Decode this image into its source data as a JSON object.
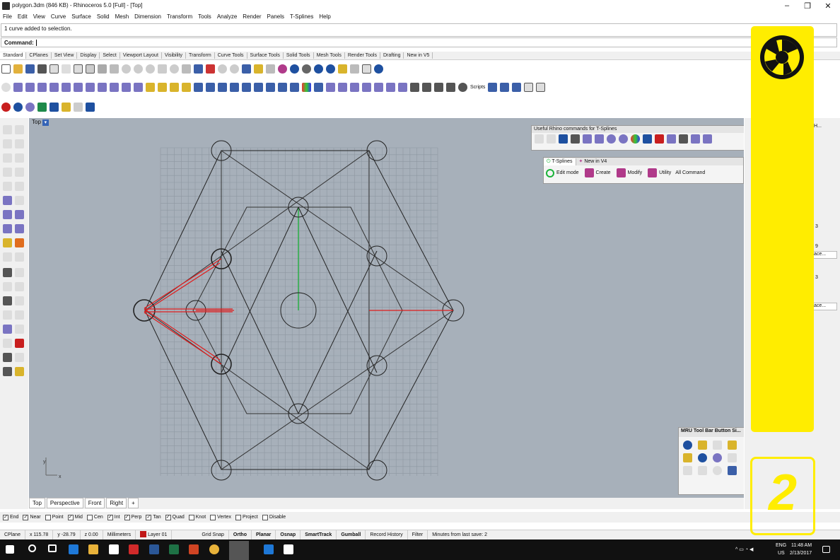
{
  "window": {
    "title": "polygon.3dm (846 KB) - Rhinoceros 5.0 [Full] - [Top]",
    "minimize_glyph": "–",
    "maximize_glyph": "❐",
    "close_glyph": "✕"
  },
  "menu": [
    "File",
    "Edit",
    "View",
    "Curve",
    "Surface",
    "Solid",
    "Mesh",
    "Dimension",
    "Transform",
    "Tools",
    "Analyze",
    "Render",
    "Panels",
    "T-Splines",
    "Help"
  ],
  "command": {
    "history": "1 curve added to selection.",
    "prompt": "Command:"
  },
  "toolbar_tabs": [
    "Standard",
    "CPlanes",
    "Set View",
    "Display",
    "Select",
    "Viewport Layout",
    "Visibility",
    "Transform",
    "Curve Tools",
    "Surface Tools",
    "Solid Tools",
    "Mesh Tools",
    "Render Tools",
    "Drafting",
    "New in V5"
  ],
  "toolbar_row3": {
    "scripts_label": "Scripts"
  },
  "viewport": {
    "name": "Top",
    "dropdown_glyph": "▾",
    "axis_y": "y",
    "axis_x": "x"
  },
  "useful_panel": {
    "title": "Useful Rhino commands for T-Splines"
  },
  "tsplines_panel": {
    "tabs": [
      "T-Splines",
      "New in V4"
    ],
    "buttons": [
      "Edit mode",
      "Create",
      "Modify",
      "Utility",
      "All Command"
    ]
  },
  "mru_panel": {
    "title": "MRU Tool Bar Button Si..."
  },
  "view_tabs": [
    "Top",
    "Perspective",
    "Front",
    "Right"
  ],
  "view_tab_add": "+",
  "osnaps": [
    {
      "label": "End",
      "checked": true
    },
    {
      "label": "Near",
      "checked": true
    },
    {
      "label": "Point",
      "checked": false
    },
    {
      "label": "Mid",
      "checked": true
    },
    {
      "label": "Cen",
      "checked": false
    },
    {
      "label": "Int",
      "checked": true
    },
    {
      "label": "Perp",
      "checked": true
    },
    {
      "label": "Tan",
      "checked": true
    },
    {
      "label": "Quad",
      "checked": true
    },
    {
      "label": "Knot",
      "checked": false
    },
    {
      "label": "Vertex",
      "checked": false
    },
    {
      "label": "Project",
      "checked": false
    },
    {
      "label": "Disable",
      "checked": false
    }
  ],
  "status": {
    "cplane": "CPlane",
    "x": "x 115.78",
    "y": "y -28.79",
    "z": "z 0.00",
    "units": "Millimeters",
    "layer": "Layer 01",
    "toggles": [
      "Grid Snap",
      "Ortho",
      "Planar",
      "Osnap",
      "SmartTrack",
      "Gumball",
      "Record History",
      "Filter"
    ],
    "save_info": "Minutes from last save: 2"
  },
  "right_panel": {
    "tab_label": "H...",
    "value_a": "3",
    "value_b": "9",
    "value_c": "3",
    "button_a": "ace...",
    "button_b": "ace..."
  },
  "tray": {
    "lang": "ENG",
    "region": "US",
    "time": "11:48 AM",
    "date": "2/13/2017"
  },
  "overlay": {
    "counter": "2"
  },
  "colors": {
    "viewport_bg": "#a7b0ba",
    "grid_line": "#8e97a1",
    "grid_major": "#7e8791",
    "selection": "#e01e1e",
    "overlay_yellow": "#ffed00",
    "axis_green": "#1bb23a"
  }
}
